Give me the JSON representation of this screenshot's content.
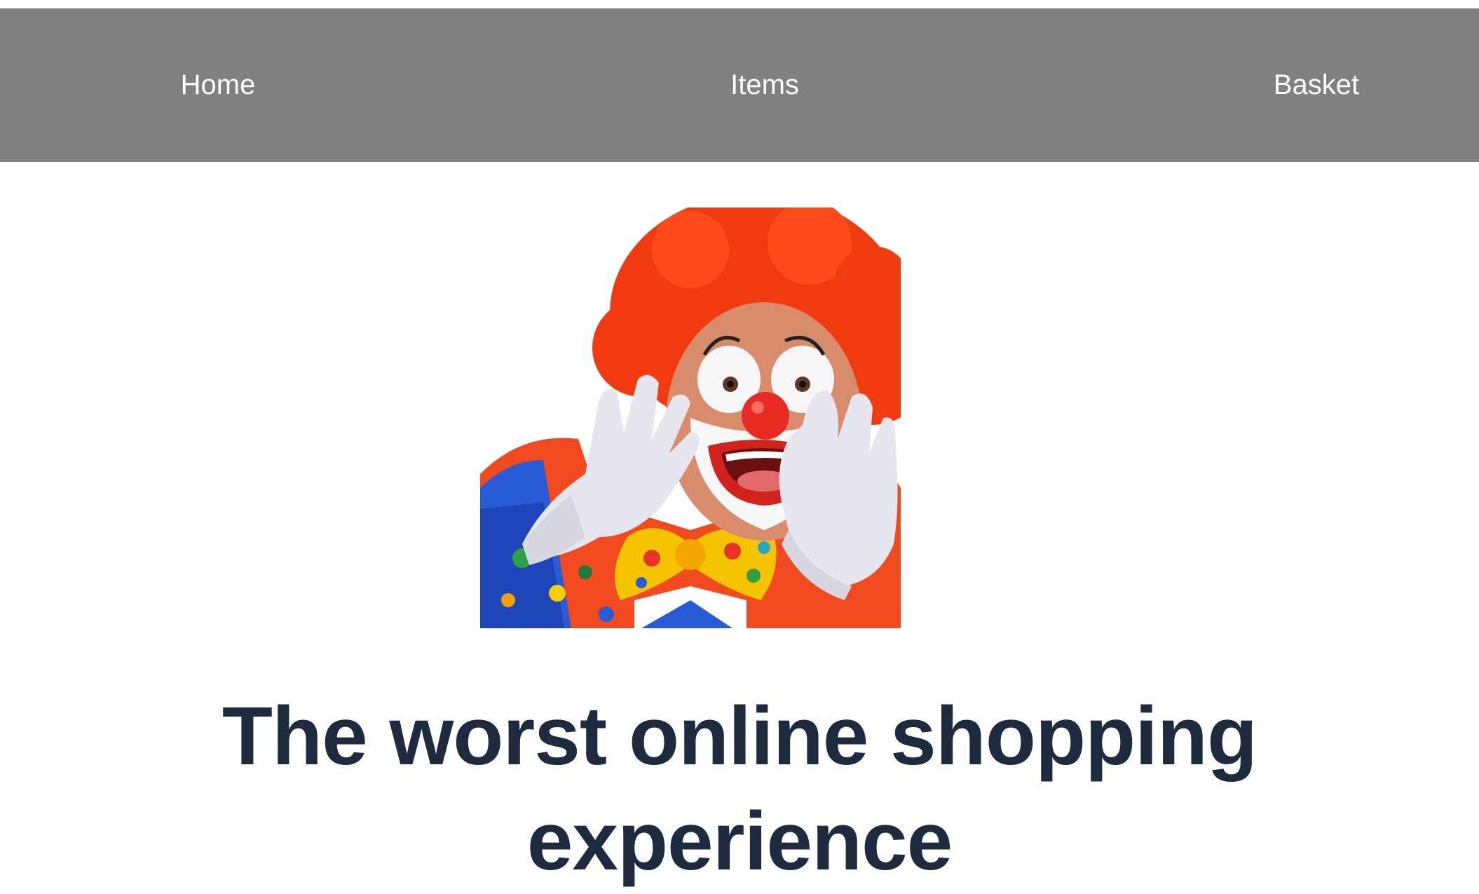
{
  "nav": {
    "home_label": "Home",
    "items_label": "Items",
    "basket_label": "Basket",
    "background_color": "#808080",
    "text_color": "#ffffff"
  },
  "hero": {
    "image_icon": "shouting-clown-image"
  },
  "headline": {
    "text": "The worst online shopping experience",
    "color": "#1e2a3d"
  }
}
